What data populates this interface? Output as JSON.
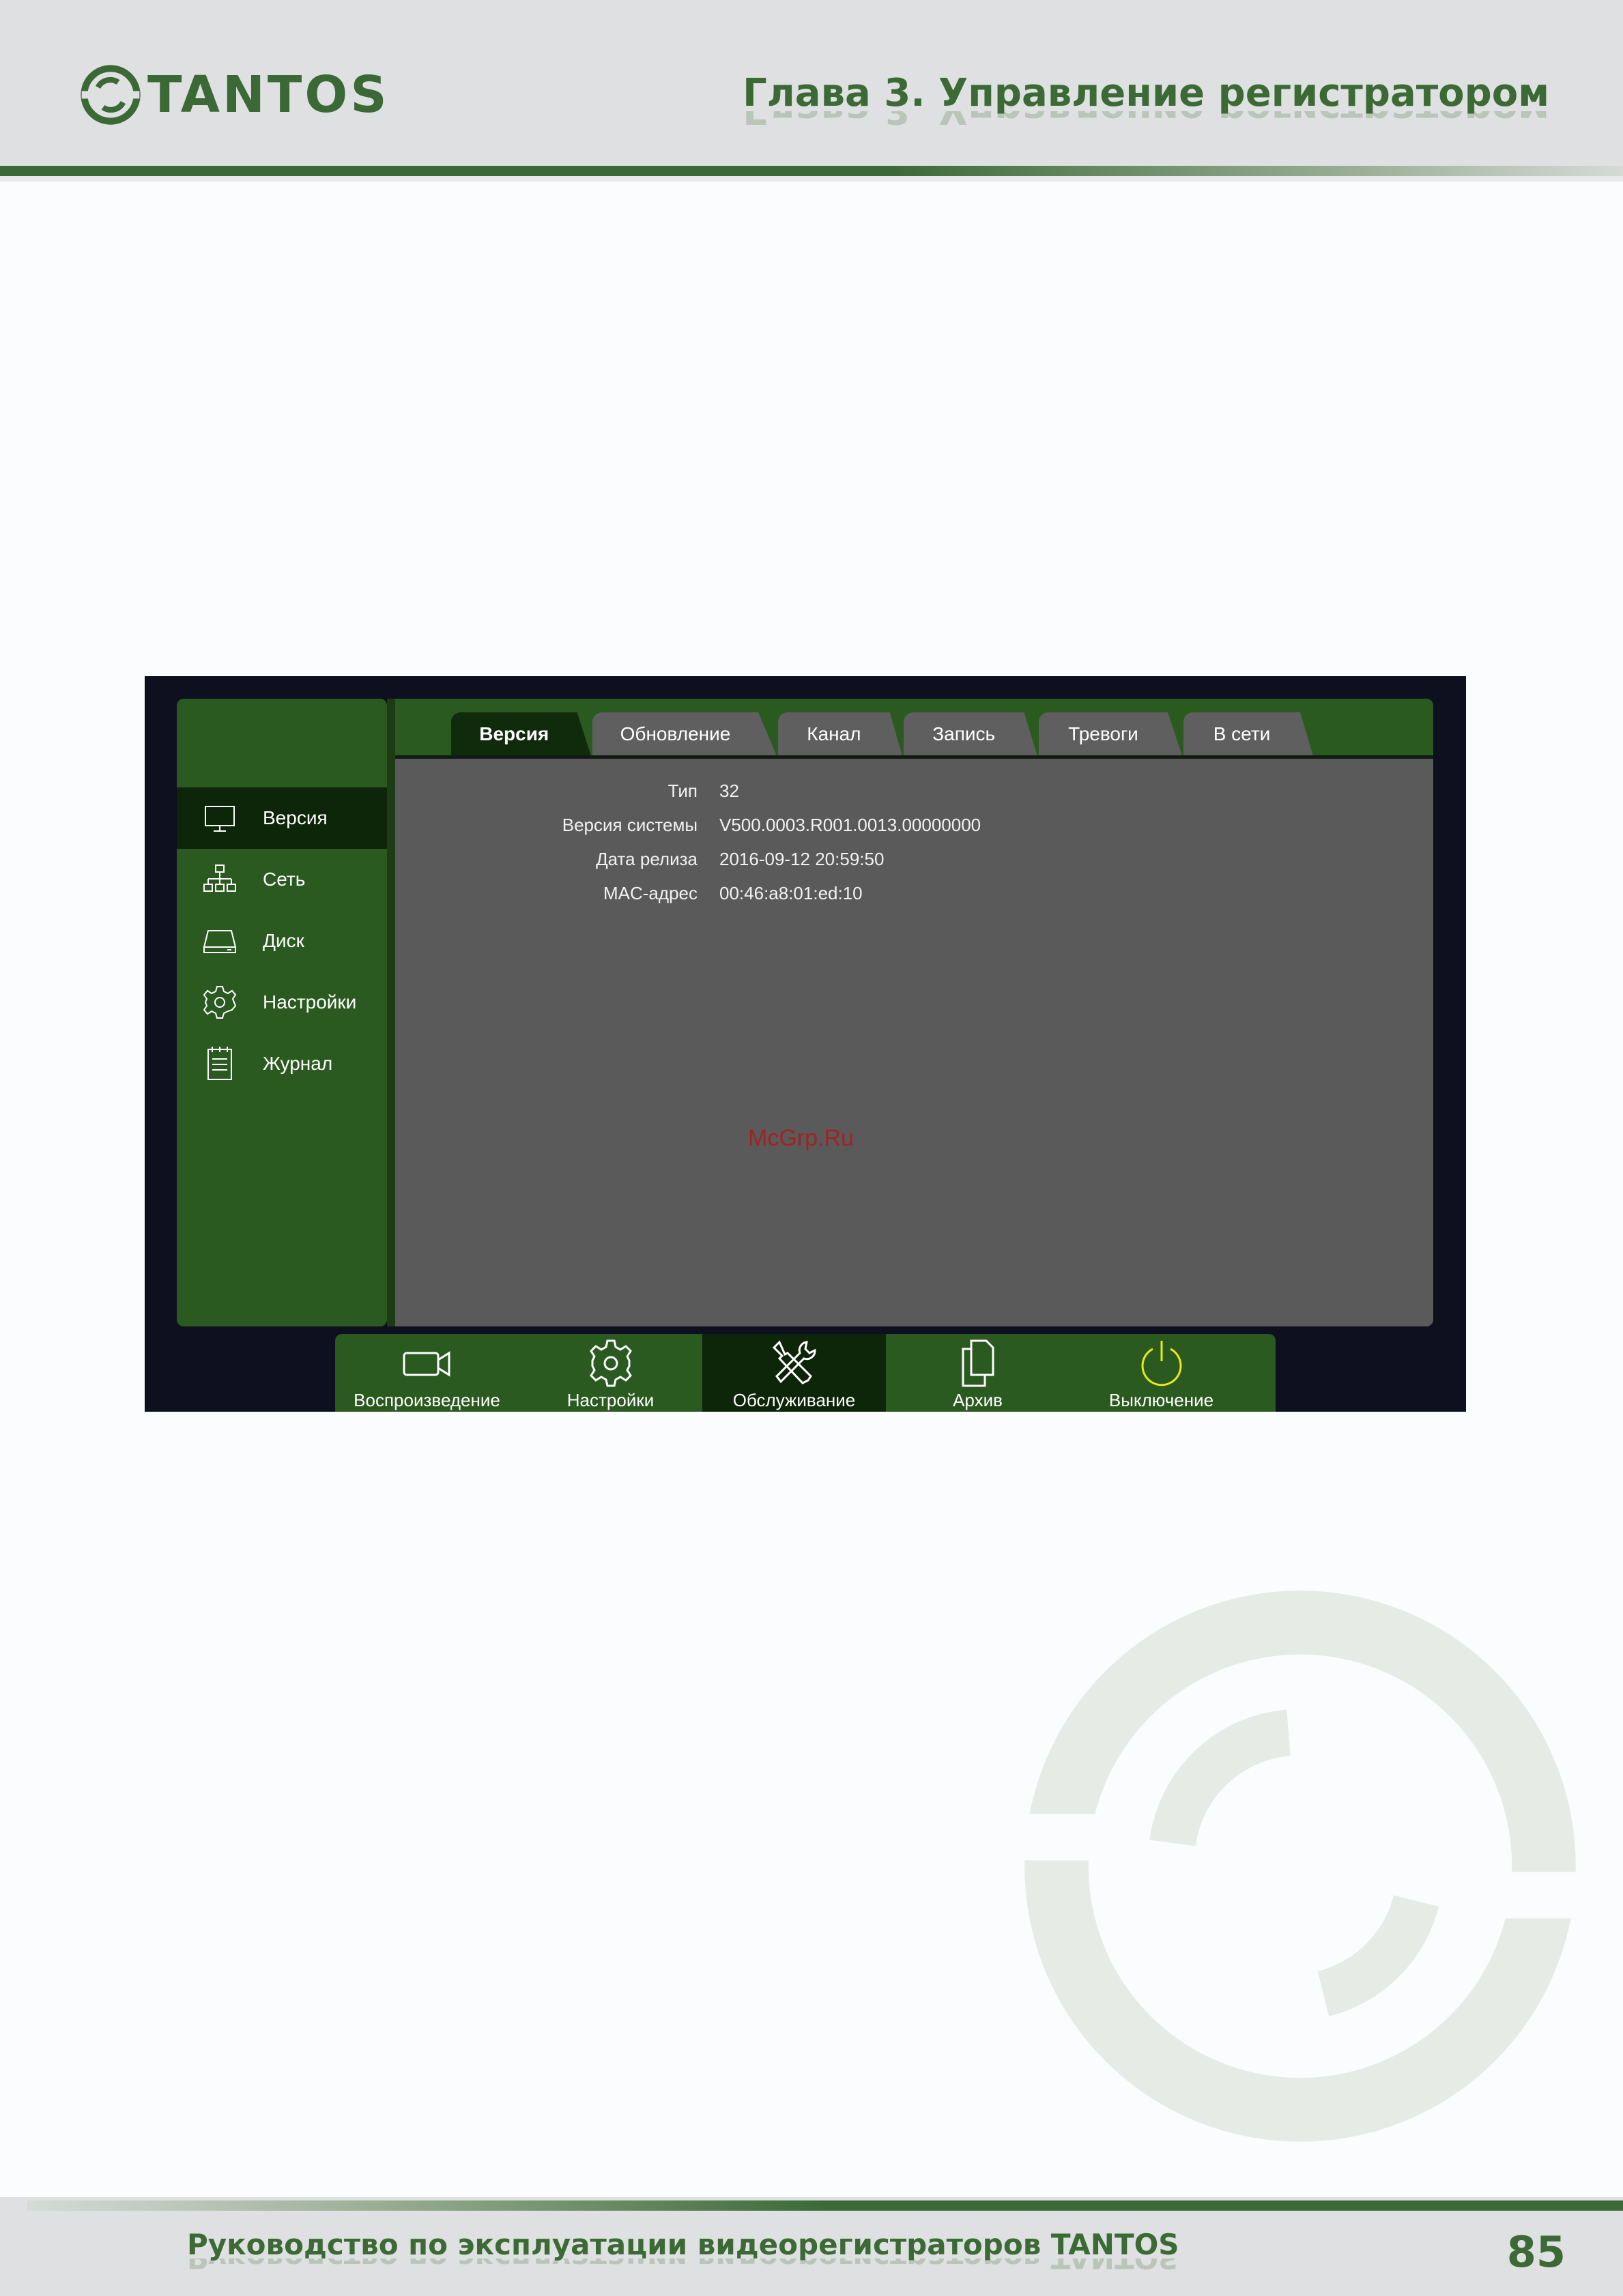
{
  "header": {
    "logo_text": "TANTOS",
    "chapter_title": "Глава 3. Управление регистратором"
  },
  "dvr": {
    "sidebar": [
      {
        "label": "Версия",
        "icon": "monitor-icon",
        "active": true
      },
      {
        "label": "Сеть",
        "icon": "network-icon",
        "active": false
      },
      {
        "label": "Диск",
        "icon": "disk-icon",
        "active": false
      },
      {
        "label": "Настройки",
        "icon": "gear-icon",
        "active": false
      },
      {
        "label": "Журнал",
        "icon": "log-icon",
        "active": false
      }
    ],
    "tabs": [
      {
        "label": "Версия",
        "active": true
      },
      {
        "label": "Обновление",
        "active": false
      },
      {
        "label": "Канал",
        "active": false
      },
      {
        "label": "Запись",
        "active": false
      },
      {
        "label": "Тревоги",
        "active": false
      },
      {
        "label": "В сети",
        "active": false
      }
    ],
    "info": [
      {
        "label": "Тип",
        "value": "32"
      },
      {
        "label": "Версия системы",
        "value": "V500.0003.R001.0013.00000000"
      },
      {
        "label": "Дата релиза",
        "value": "2016-09-12 20:59:50"
      },
      {
        "label": "MAC-адрес",
        "value": "00:46:a8:01:ed:10"
      }
    ],
    "stamp": "McGrp.Ru",
    "bottom_menu": [
      {
        "label": "Воспроизведение",
        "icon": "camera-icon",
        "active": false
      },
      {
        "label": "Настройки",
        "icon": "gear-icon",
        "active": false
      },
      {
        "label": "Обслуживание",
        "icon": "tools-icon",
        "active": true
      },
      {
        "label": "Архив",
        "icon": "copy-icon",
        "active": false
      },
      {
        "label": "Выключение",
        "icon": "power-icon",
        "active": false
      }
    ],
    "colors": {
      "panel_green": "#2a5a20",
      "active_dark": "#0d2509",
      "content_gray": "#5a5a5a",
      "power_yellow": "#e8e81c"
    }
  },
  "footer": {
    "title": "Руководство по эксплуатации видеорегистраторов TANTOS",
    "page_number": "85"
  }
}
